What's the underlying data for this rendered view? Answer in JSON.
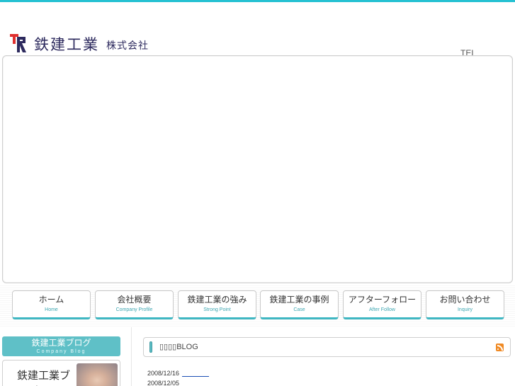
{
  "brand": {
    "name": "鉄建工業",
    "suffix": "株式会社",
    "mark_colors": {
      "primary": "#2d2a5e",
      "accent": "#e0302f"
    }
  },
  "header": {
    "tel_label": "TEL"
  },
  "colors": {
    "accent": "#25c1d2",
    "tab": "#5fc0c7",
    "rss": "#f08a24"
  },
  "nav": {
    "items": [
      {
        "ja": "ホーム",
        "en": "Home"
      },
      {
        "ja": "会社概要",
        "en": "Company Profile"
      },
      {
        "ja": "鉄建工業の強み",
        "en": "Strong Point"
      },
      {
        "ja": "鉄建工業の事例",
        "en": "Case"
      },
      {
        "ja": "アフターフォロー",
        "en": "After Follow"
      },
      {
        "ja": "お問い合わせ",
        "en": "Inquiry"
      }
    ]
  },
  "sidebar": {
    "blog_tab": {
      "ja": "鉄建工業ブログ",
      "en": "Company Blog"
    },
    "banner": {
      "text": "鉄建工業ブログ"
    }
  },
  "blog": {
    "panel_title": "▯▯▯▯BLOG",
    "rss_icon": "rss-icon",
    "entries": [
      {
        "date": "2008/12/16"
      },
      {
        "date": "2008/12/05"
      }
    ]
  }
}
